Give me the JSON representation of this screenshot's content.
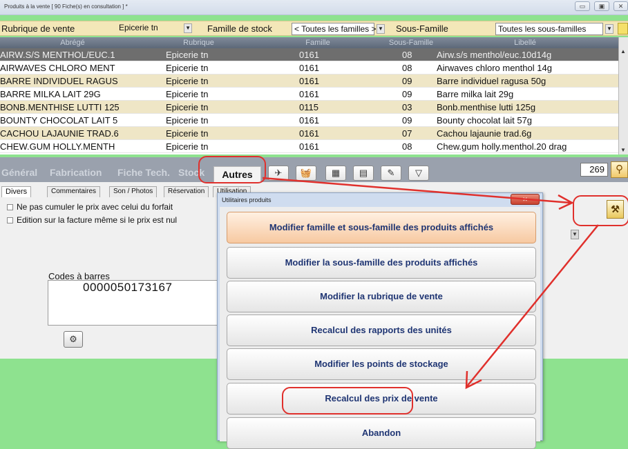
{
  "window": {
    "title": "Produits à la vente  [ 90 Fiche(s) en consultation ] *"
  },
  "filters": {
    "rubrique_label": "Rubrique de vente",
    "rubrique_value": "Epicerie tn",
    "famille_label": "Famille de stock",
    "famille_value": "< Toutes les familles >",
    "sous_famille_label": "Sous-Famille",
    "sous_famille_value": "Toutes les sous-familles"
  },
  "table": {
    "columns": [
      "Abrégé",
      "Rubrique",
      "Famille",
      "Sous-Famille",
      "Libellé"
    ],
    "rows": [
      [
        "AIRW.S/S MENTHOL/EUC.1",
        "Epicerie tn",
        "0161",
        "08",
        "Airw.s/s menthol/euc.10d14g"
      ],
      [
        "AIRWAVES CHLORO MENT",
        "Epicerie tn",
        "0161",
        "08",
        "Airwaves chloro menthol 14g"
      ],
      [
        "BARRE INDIVIDUEL RAGUS",
        "Epicerie tn",
        "0161",
        "09",
        "Barre individuel ragusa 50g"
      ],
      [
        "BARRE MILKA LAIT 29G",
        "Epicerie tn",
        "0161",
        "09",
        "Barre milka lait 29g"
      ],
      [
        "BONB.MENTHISE LUTTI 125",
        "Epicerie tn",
        "0115",
        "03",
        "Bonb.menthise lutti 125g"
      ],
      [
        "BOUNTY CHOCOLAT LAIT 5",
        "Epicerie tn",
        "0161",
        "09",
        "Bounty chocolat lait 57g"
      ],
      [
        "CACHOU LAJAUNIE TRAD.6",
        "Epicerie tn",
        "0161",
        "07",
        "Cachou lajaunie trad.6g"
      ],
      [
        "CHEW.GUM HOLLY.MENTH",
        "Epicerie tn",
        "0161",
        "08",
        "Chew.gum holly.menthol.20 drag"
      ]
    ]
  },
  "tabs": {
    "items": [
      "Général",
      "Fabrication",
      "Fiche Tech.",
      "Stock"
    ],
    "active": "Autres"
  },
  "count": "269",
  "subtabs": [
    "Divers",
    "Commentaires",
    "Son / Photos",
    "Réservation",
    "Utilisation"
  ],
  "options": {
    "opt1": "Ne pas cumuler le prix avec celui du forfait",
    "opt2": "Edition sur la facture même si le prix est nul"
  },
  "barcodes": {
    "label": "Codes à barres",
    "value": "0000050173167"
  },
  "dialog": {
    "title": "Utilitaires produits",
    "buttons": [
      "Modifier famille et sous-famille des produits affichés",
      "Modifier la sous-famille des produits affichés",
      "Modifier la rubrique de vente",
      "Recalcul des rapports des unités",
      "Modifier les points de stockage",
      "Recalcul des prix de vente",
      "Abandon"
    ]
  },
  "colors": {
    "annotation": "#e0302c",
    "background": "#8ee28f",
    "selected_row": "#6e6e6e",
    "alt_row": "#efe6c6"
  }
}
